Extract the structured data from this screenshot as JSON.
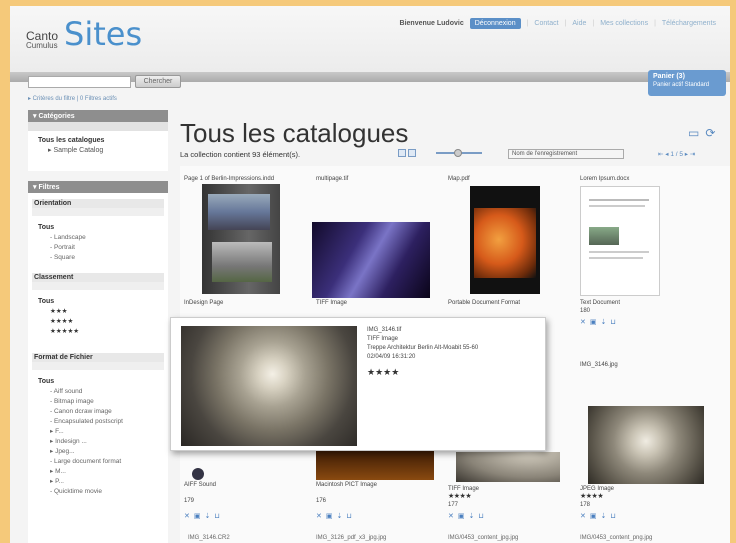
{
  "header": {
    "logo_small_top": "Canto",
    "logo_small_bottom": "Cumulus",
    "logo_big": "Sites",
    "welcome": "Bienvenue Ludovic",
    "logout": "Déconnexion",
    "nav": [
      "Contact",
      "Aide",
      "Mes collections",
      "Téléchargements"
    ]
  },
  "search": {
    "button": "Chercher",
    "value": ""
  },
  "filter_summary": "▸ Critères du filtre | 0 Filtres actifs",
  "basket": {
    "title": "Panier (3)",
    "actions": "Panier actif  Standard"
  },
  "sidebar": {
    "categories_head": "▾ Catégories",
    "cat_all": "Tous les catalogues",
    "cat_item": "▸ Sample Catalog",
    "filters_head": "▾ Filtres",
    "orientation_label": "Orientation",
    "orientation_all": "Tous",
    "orientation_items": [
      "- Landscape",
      "- Portrait",
      "- Square"
    ],
    "rating_label": "Classement",
    "rating_all": "Tous",
    "rating_items": [
      "★★★",
      "★★★★",
      "★★★★★"
    ],
    "format_label": "Format de Fichier",
    "format_all": "Tous",
    "format_items": [
      "- Aiff sound",
      "- Bitmap image",
      "- Canon dcraw image",
      "- Encapsulated postscript",
      "▸ F...",
      "▸ Indesign ...",
      "▸ Jpeg...",
      "- Large document format",
      "▸ M...",
      "▸ P...",
      "- Quicktime movie"
    ]
  },
  "main": {
    "title": "Tous les catalogues",
    "count": "La collection contient 93 élément(s).",
    "sort": "Nom de l'enregistrement",
    "pager": "⇤ ◂ 1 / 5 ▸ ⇥"
  },
  "cards": [
    {
      "fname": "Page 1 of Berlin-Impressions.indd",
      "ftype": "InDesign Page",
      "meta": "",
      "rating": ""
    },
    {
      "fname": "multipage.tif",
      "ftype": "TIFF Image",
      "meta": "",
      "rating": ""
    },
    {
      "fname": "Map.pdf",
      "ftype": "Portable Document Format",
      "meta": "",
      "rating": ""
    },
    {
      "fname": "Lorem Ipsum.docx",
      "ftype": "Text Document",
      "meta": "180",
      "rating": ""
    },
    {
      "fname": "",
      "ftype": "AIFF Sound",
      "meta": "179",
      "rating": ""
    },
    {
      "fname": "",
      "ftype": "Macintosh PICT Image",
      "meta": "176",
      "rating": ""
    },
    {
      "fname": "",
      "ftype": "TIFF Image",
      "meta": "177",
      "rating": "★★★★"
    },
    {
      "fname": "IMG_3146.jpg",
      "ftype": "JPEG Image",
      "meta": "178",
      "rating": "★★★★"
    }
  ],
  "popup": {
    "line1": "IMG_3146.tif",
    "line2": "TIFF Image",
    "line3": "Treppe Architektur Berlin Alt-Moabit 55-60",
    "line4": "02/04/09 16:31:20",
    "stars": "★★★★"
  },
  "bottom_row": [
    "IMG_3146.CR2",
    "IMG_3126_pdf_x3_jpg.jpg",
    "IMG/0453_content_jpg.jpg",
    "IMG/0453_content_png.jpg"
  ]
}
